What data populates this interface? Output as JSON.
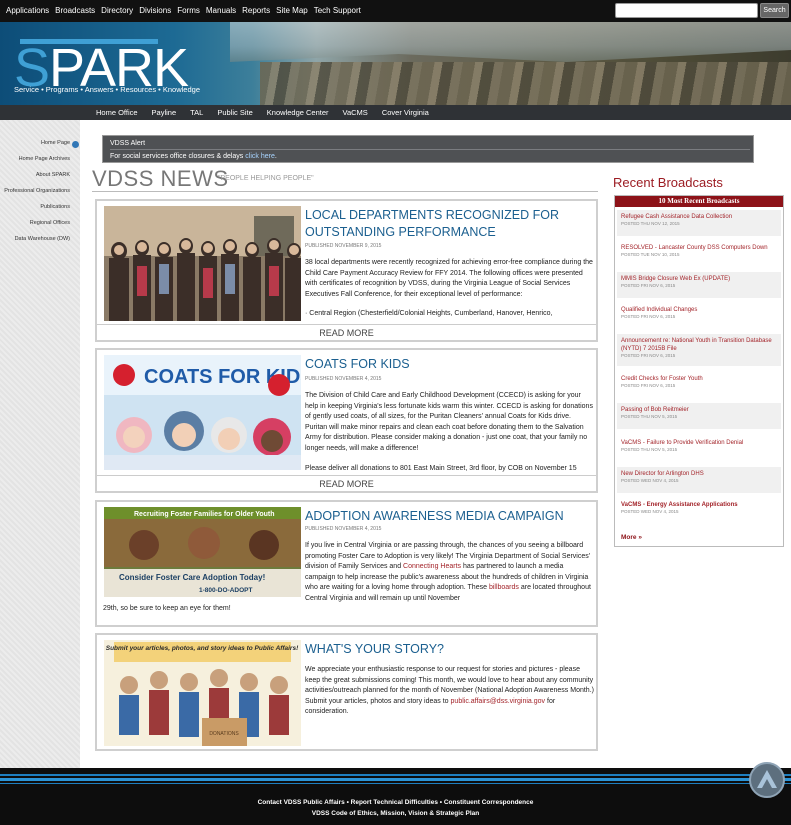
{
  "topnav": [
    "Applications",
    "Broadcasts",
    "Directory",
    "Divisions",
    "Forms",
    "Manuals",
    "Reports",
    "Site Map",
    "Tech Support"
  ],
  "search": {
    "placeholder": "",
    "button": "Search"
  },
  "banner": {
    "logo": "PARK",
    "logo_s": "S",
    "tagline": "Service • Programs • Answers • Resources • Knowledge"
  },
  "subnav": [
    "Home Office",
    "Payline",
    "TAL",
    "Public Site",
    "Knowledge Center",
    "VaCMS",
    "Cover Virginia"
  ],
  "sidebar": [
    "Home Page",
    "Home Page Archives",
    "About SPARK",
    "Professional Organizations",
    "Publications",
    "Regional Offices",
    "Data Warehouse (DW)"
  ],
  "alert": {
    "title": "VDSS Alert",
    "text": "For social services office closures & delays ",
    "link": "click here",
    "end": "."
  },
  "news": {
    "heading": "VDSS NEWS",
    "sub": "\"PEOPLE HELPING PEOPLE\""
  },
  "articles": [
    {
      "title": "LOCAL DEPARTMENTS RECOGNIZED FOR OUTSTANDING PERFORMANCE",
      "date": "PUBLISHED NOVEMBER 9, 2015",
      "body1": "38 local departments were recently recognized for achieving error-free compliance during the Child Care Payment Accuracy Review for FFY 2014. The following offices were presented with certificates of recognition by VDSS, during the Virginia League of Social Services Executives Fall Conference, for their exceptional level of performance:",
      "body2": "· Central Region (Chesterfield/Colonial Heights, Cumberland, Hanover, Henrico,",
      "more": "READ MORE"
    },
    {
      "title": "COATS FOR KIDS",
      "date": "PUBLISHED NOVEMBER 4, 2015",
      "body1": "The Division of Child Care and Early Childhood Development (CCECD) is asking for your help in keeping Virginia's less fortunate kids warm this winter. CCECD is asking for donations of gently used coats, of all sizes, for the Puritan Cleaners' annual Coats for Kids drive. Puritan will make minor repairs and clean each coat before donating them to the Salvation Army for distribution. Please consider making a donation - just one coat, that your family no longer needs, will make a difference!",
      "body2": "Please deliver all donations to 801 East Main Street, 3rd floor, by COB on November 15",
      "more": "READ MORE",
      "img_text": "COATS FOR KIDS"
    },
    {
      "title": "ADOPTION AWARENESS MEDIA CAMPAIGN",
      "date": "PUBLISHED NOVEMBER 4, 2015",
      "body_a": "If you live in Central Virginia or are passing through, the chances of you seeing a billboard promoting Foster Care to Adoption is very likely! The Virginia Department of Social Services' division of Family Services and ",
      "link1": "Connecting Hearts",
      "body_b": " has partnered to launch a media campaign to help increase the public's awareness about the hundreds of children in Virginia who are waiting for a loving home through adoption. These ",
      "link2": "billboards",
      "body_c": " are located throughout Central Virginia and will remain up until November",
      "body_d": "29th, so be sure to keep an eye for them!",
      "img_top": "Recruiting Foster Families for Older Youth",
      "img_mid": "Consider Foster Care Adoption Today!",
      "img_bot": "1-800-DO-ADOPT"
    },
    {
      "title": "WHAT'S YOUR STORY?",
      "body_a": "We appreciate your enthusiastic response to our request for stories and pictures - please keep the great submissions coming! This month, we would love to hear about any community activities/outreach planned for the month of November (National Adoption Awareness Month.) Submit your articles, photos and story ideas to ",
      "link": "public.affairs@dss.virginia.gov",
      "body_b": " for consideration.",
      "img_text": "Submit your articles, photos, and story ideas to Public Affairs!",
      "box_text": "DONATIONS"
    }
  ],
  "recent": {
    "heading": "Recent Broadcasts",
    "bar": "10 Most Recent Broadcasts",
    "items": [
      {
        "title": "Refugee Cash Assistance Data Collection",
        "date": "POSTED THU NOV 12, 2015"
      },
      {
        "title": "RESOLVED - Lancaster County DSS Computers Down",
        "date": "POSTED TUE NOV 10, 2015"
      },
      {
        "title": "MMIS Bridge Closure Web Ex (UPDATE)",
        "date": "POSTED FRI NOV 6, 2015"
      },
      {
        "title": "Qualified Individual Changes",
        "date": "POSTED FRI NOV 6, 2015"
      },
      {
        "title": "Announcement re: National Youth in Transition Database (NYTD) 7 2015B File",
        "date": "POSTED FRI NOV 6, 2015"
      },
      {
        "title": "Credit Checks for Foster Youth",
        "date": "POSTED FRI NOV 6, 2015"
      },
      {
        "title": "Passing of Bob Reitmeier",
        "date": "POSTED THU NOV 5, 2015"
      },
      {
        "title": "VaCMS - Failure to Provide Verification Denial",
        "date": "POSTED THU NOV 5, 2015"
      },
      {
        "title": "New Director for Arlington DHS",
        "date": "POSTED WED NOV 4, 2015"
      },
      {
        "title": "VaCMS - Energy Assistance Applications",
        "date": "POSTED WED NOV 4, 2015"
      }
    ],
    "more": "More »"
  },
  "footer": {
    "line1": "Contact VDSS Public Affairs • Report Technical Difficulties • Constituent Correspondence",
    "line2": "VDSS Code of Ethics, Mission, Vision & Strategic Plan"
  }
}
